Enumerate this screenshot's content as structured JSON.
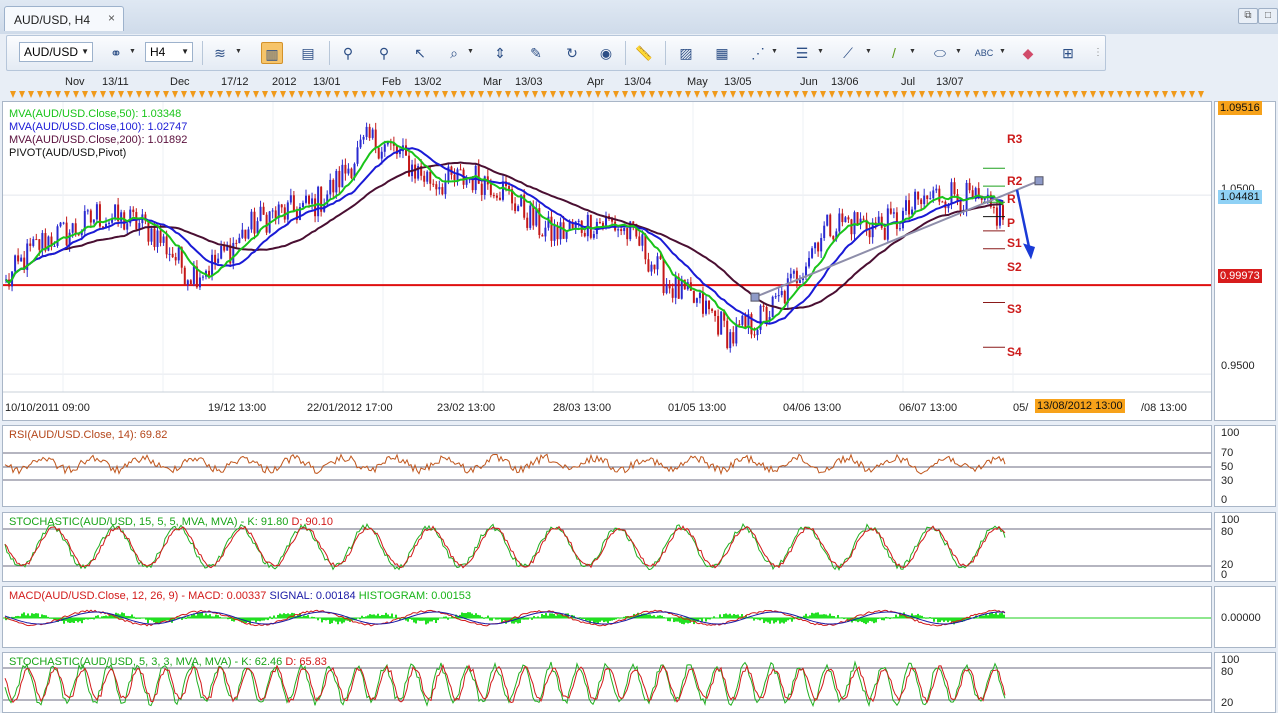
{
  "tab": {
    "title": "AUD/USD, H4",
    "close": "×"
  },
  "window_buttons": [
    "⧉",
    "□"
  ],
  "toolbar": {
    "symbol": "AUD/USD",
    "timeframe": "H4",
    "icons": [
      "link-icon",
      "bar-chart-icon",
      "candlestick-icon",
      "line-chart-icon",
      "crosshair-icon",
      "zoom-in-icon",
      "zoom-out-icon",
      "cursor-icon",
      "zoom-area-icon",
      "fit-icon",
      "edit-icon",
      "rotate-icon",
      "globe-icon",
      "ruler-icon",
      "picture-icon",
      "template-icon",
      "fibonacci-icon",
      "channel-icon",
      "trendline-icon",
      "line-icon",
      "ellipse-icon",
      "text-icon",
      "eraser-icon",
      "object-tree-icon"
    ]
  },
  "top_axis": {
    "labels": [
      "Nov",
      "13/11",
      "Dec",
      "17/12",
      "2012",
      "13/01",
      "Feb",
      "13/02",
      "Mar",
      "13/03",
      "Apr",
      "13/04",
      "May",
      "13/05",
      "Jun",
      "13/06",
      "Jul",
      "13/07"
    ]
  },
  "main_chart": {
    "legend": [
      {
        "text": "MVA(AUD/USD.Close,50): 1.03348",
        "color": "#19c419"
      },
      {
        "text": "MVA(AUD/USD.Close,100): 1.02747",
        "color": "#1a1ad6"
      },
      {
        "text": "MVA(AUD/USD.Close,200): 1.01892",
        "color": "#5a0f3c"
      },
      {
        "text": "PIVOT(AUD/USD,Pivot)",
        "color": "#111111"
      }
    ],
    "price_ticks": [
      "1.0500",
      "0.9500"
    ],
    "price_tags": [
      {
        "text": "1.09516",
        "bg": "#f7a21a",
        "color": "#111111"
      },
      {
        "text": "1.04481",
        "bg": "#8fd1f5",
        "color": "#111111"
      },
      {
        "text": "0.99973",
        "bg": "#d71c1c",
        "color": "#ffffff"
      }
    ],
    "pivot_labels": [
      "R3",
      "R2",
      "R",
      "P",
      "S1",
      "S2",
      "S3",
      "S4"
    ],
    "date_labels": [
      "10/10/2011 09:00",
      "19/12 13:00",
      "22/01/2012 17:00",
      "23/02 13:00",
      "28/03 13:00",
      "01/05 13:00",
      "04/06 13:00",
      "06/07 13:00",
      "05/",
      "/08 13:00"
    ],
    "current_date_tag": "13/08/2012 13:00",
    "colors": {
      "support_line": "#e01010",
      "ma50": "#19c419",
      "ma100": "#1a1ad6",
      "ma200": "#4a0f32",
      "trend": "#8e8eaa",
      "arrow": "#1a3ad6",
      "bull": "#2a2ad0",
      "bear": "#c41818"
    }
  },
  "rsi": {
    "label": "RSI(AUD/USD.Close, 14): 69.82",
    "ticks": [
      "100",
      "70",
      "50",
      "30",
      "0"
    ]
  },
  "stoch1": {
    "label_main": "STOCHASTIC(AUD/USD, 15, 5, 5, MVA, MVA) -",
    "label_k": "K: 91.80",
    "label_d": "D: 90.10",
    "ticks": [
      "100",
      "80",
      "20",
      "0"
    ]
  },
  "macd": {
    "label_main": "MACD(AUD/USD.Close, 12, 26, 9) -",
    "label_macd": "MACD: 0.00337",
    "label_signal": "SIGNAL: 0.00184",
    "label_hist": "HISTOGRAM: 0.00153",
    "ticks": [
      "0.00000"
    ]
  },
  "stoch2": {
    "label_main": "STOCHASTIC(AUD/USD, 5, 3, 3, MVA, MVA) -",
    "label_k": "K: 62.46",
    "label_d": "D: 65.83",
    "ticks": [
      "100",
      "80",
      "20"
    ]
  },
  "chart_data": {
    "type": "candlestick",
    "symbol": "AUD/USD",
    "timeframe": "H4",
    "x": [
      "10/10/2011",
      "01/11/2011",
      "01/12/2011",
      "01/01/2012",
      "01/02/2012",
      "01/03/2012",
      "01/04/2012",
      "01/05/2012",
      "01/06/2012",
      "01/07/2012",
      "01/08/2012",
      "13/08/2012"
    ],
    "close_approx": [
      1.0,
      1.045,
      1.01,
      1.035,
      1.075,
      1.06,
      1.035,
      1.025,
      0.965,
      1.025,
      1.045,
      1.04481
    ],
    "ylim": [
      0.94,
      1.102
    ],
    "horizontal_line": 0.99973,
    "pivot_levels": {
      "R3": 1.065,
      "R2": 1.055,
      "R": 1.046,
      "P": 1.038,
      "S1": 1.03,
      "S2": 1.02,
      "S3": 0.99,
      "S4": 0.965
    },
    "indicators": {
      "MVA50": 1.03348,
      "MVA100": 1.02747,
      "MVA200": 1.01892,
      "RSI14": 69.82,
      "Stoch_15_5_5": {
        "K": 91.8,
        "D": 90.1
      },
      "MACD": {
        "macd": 0.00337,
        "signal": 0.00184,
        "histogram": 0.00153
      },
      "Stoch_5_3_3": {
        "K": 62.46,
        "D": 65.83
      }
    }
  }
}
